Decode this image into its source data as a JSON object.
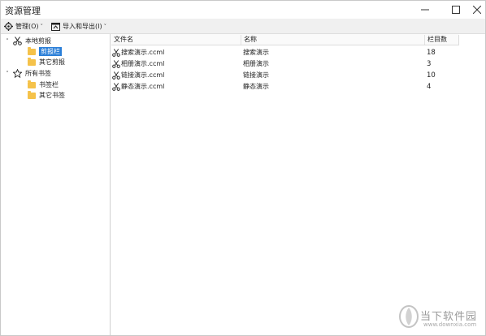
{
  "window": {
    "title": "资源管理"
  },
  "toolbar": {
    "manage_label": "管理(O)",
    "import_label": "导入和导出(I)",
    "caret": "˅"
  },
  "tree": {
    "groups": [
      {
        "label": "本地剪报",
        "toggle": "˅",
        "icon": "scissors-icon",
        "children": [
          {
            "label": "剪报栏",
            "selected": true
          },
          {
            "label": "其它剪报",
            "selected": false
          }
        ]
      },
      {
        "label": "所有书签",
        "toggle": "˅",
        "icon": "star-icon",
        "children": [
          {
            "label": "书签栏",
            "selected": false
          },
          {
            "label": "其它书签",
            "selected": false
          }
        ]
      }
    ]
  },
  "list": {
    "columns": [
      "文件名",
      "名称",
      "栏目数"
    ],
    "rows": [
      {
        "file": "搜索演示.ccml",
        "name": "搜索演示",
        "count": "18"
      },
      {
        "file": "相册演示.ccml",
        "name": "相册演示",
        "count": "3"
      },
      {
        "file": "链接演示.ccml",
        "name": "链接演示",
        "count": "10"
      },
      {
        "file": "静态演示.ccml",
        "name": "静态演示",
        "count": "4"
      }
    ]
  },
  "watermark": {
    "brand": "当下软件园",
    "url": "www.downxia.com"
  },
  "colors": {
    "selection": "#2b7fd8",
    "folder": "#f5c24a",
    "toolbar_bg": "#f0f0f0"
  }
}
